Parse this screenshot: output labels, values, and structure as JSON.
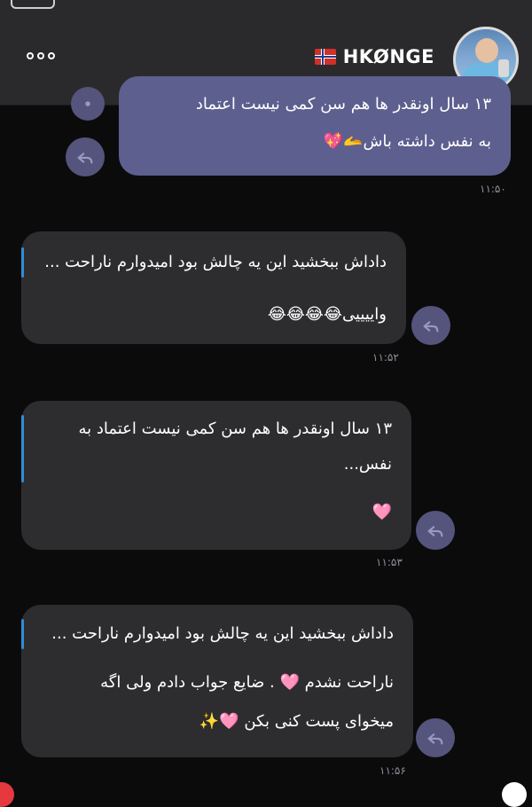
{
  "header": {
    "title": "HKØNGE",
    "menu_icon": "more-horizontal-icon",
    "flag": "norway-flag-icon",
    "avatar": "profile-photo"
  },
  "messages": [
    {
      "direction": "outgoing",
      "partial_top_line": "۱۳ سال اونقدر ها هم سن کمی نیست اعتماد",
      "text": "به نفس داشته باش🫴💖",
      "time": "۱۱:۵۰"
    },
    {
      "direction": "incoming",
      "quote": "داداش ببخشید این یه چالش بود امیدوارم ناراحت ...",
      "text": "واییییی😂😂😂😂",
      "time": "۱۱:۵۲"
    },
    {
      "direction": "incoming",
      "text_line1": "۱۳ سال اونقدر ها هم سن کمی نیست اعتماد به",
      "text_line2": "نفس...",
      "text_line3": "🩷",
      "time": "۱۱:۵۳"
    },
    {
      "direction": "incoming",
      "quote": "داداش ببخشید این یه چالش بود امیدوارم ناراحت ...",
      "text_line1": "ناراحت نشدم 🩷 . ضایع جواب دادم ولی اگه",
      "text_line2": "میخوای پست کنی بکن 🩷✨",
      "time": "۱۱:۵۶"
    }
  ],
  "colors": {
    "background": "#0b0b0c",
    "topbar": "#2a2a2c",
    "incoming_bubble": "#2d2d30",
    "outgoing_bubble": "#5d5f8f",
    "quote_bar": "#2f8dd8",
    "reply_button": "#54547c"
  }
}
